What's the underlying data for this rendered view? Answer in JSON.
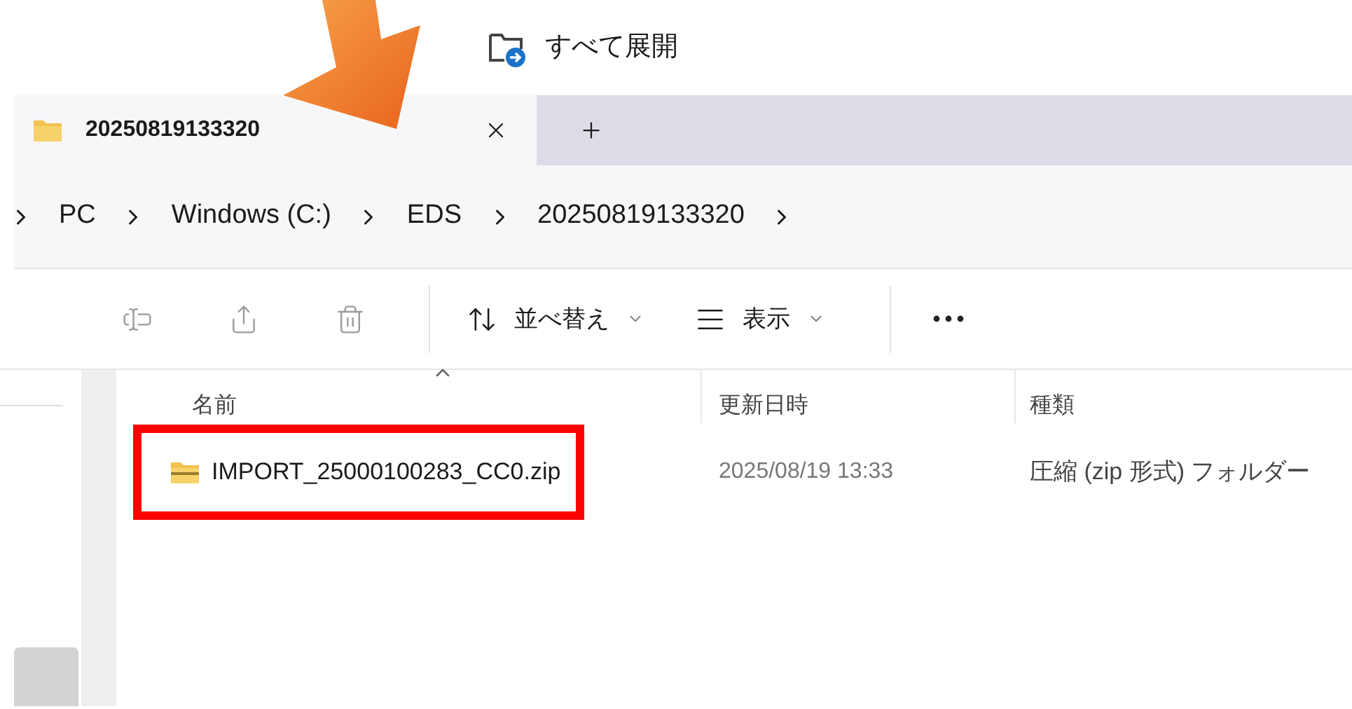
{
  "command_bar": {
    "extract_all": "すべて展開"
  },
  "tabs": [
    {
      "label": "20250819133320",
      "selected": true
    }
  ],
  "breadcrumb": [
    "PC",
    "Windows (C:)",
    "EDS",
    "20250819133320"
  ],
  "toolbar": [
    {
      "kind": "rename"
    },
    {
      "kind": "share"
    },
    {
      "kind": "delete"
    },
    {
      "kind": "divider"
    },
    {
      "kind": "sort",
      "label": "並べ替え"
    },
    {
      "kind": "view",
      "label": "表示"
    },
    {
      "kind": "divider"
    },
    {
      "kind": "more"
    }
  ],
  "columns": [
    {
      "label": "名前",
      "sorted": true
    },
    {
      "label": "更新日時",
      "sorted": false
    },
    {
      "label": "種類",
      "sorted": false
    }
  ],
  "rows": [
    {
      "name": "IMPORT_25000100283_CC0.zip",
      "modified": "2025/08/19 13:33",
      "type": "圧縮 (zip 形式) フォルダー",
      "highlighted": true
    }
  ]
}
